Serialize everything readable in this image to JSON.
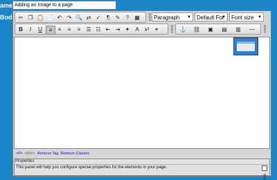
{
  "form": {
    "name_label": "ame",
    "body_label": "Body",
    "name_value": "Adding an Image to a page"
  },
  "toolbar": {
    "row1_buttons": [
      {
        "icon": "cut-icon",
        "glyph": "✂"
      },
      {
        "icon": "copy-icon",
        "glyph": "❐"
      },
      {
        "icon": "paste-icon",
        "glyph": "📋"
      },
      {
        "icon": "paste-text-icon",
        "glyph": "📄"
      },
      {
        "icon": "undo-icon",
        "glyph": "↶"
      },
      {
        "icon": "redo-icon",
        "glyph": "↷"
      },
      {
        "icon": "find-icon",
        "glyph": "🔍"
      },
      {
        "icon": "replace-icon",
        "glyph": "⇄"
      },
      {
        "icon": "spellcheck-icon",
        "glyph": "✓"
      },
      {
        "icon": "show-blocks-icon",
        "glyph": "¶"
      },
      {
        "icon": "cleanup-icon",
        "glyph": "✎"
      },
      {
        "icon": "help-icon",
        "glyph": "?"
      },
      {
        "icon": "source-icon",
        "glyph": "▦"
      }
    ],
    "paragraph_select": "Paragraph",
    "font_select": "Default For",
    "size_select": "Font size",
    "row2_buttons": [
      {
        "icon": "bold-icon",
        "glyph": "B"
      },
      {
        "icon": "italic-icon",
        "glyph": "I"
      },
      {
        "icon": "underline-icon",
        "glyph": "U"
      },
      {
        "icon": "align-left-icon",
        "glyph": "≡"
      },
      {
        "icon": "align-center-icon",
        "glyph": "≡"
      },
      {
        "icon": "align-right-icon",
        "glyph": "≡"
      },
      {
        "icon": "align-justify-icon",
        "glyph": "≡"
      },
      {
        "icon": "bullet-list-icon",
        "glyph": "☰"
      },
      {
        "icon": "numbered-list-icon",
        "glyph": "☷"
      },
      {
        "icon": "outdent-icon",
        "glyph": "⇤"
      },
      {
        "icon": "indent-icon",
        "glyph": "⇥"
      },
      {
        "icon": "highlight-color-icon",
        "glyph": "✦"
      },
      {
        "icon": "text-color-icon",
        "glyph": "A"
      },
      {
        "icon": "superscript-icon",
        "glyph": "x²"
      },
      {
        "icon": "link-icon",
        "glyph": "⚭"
      },
      {
        "icon": "anchor-icon",
        "glyph": "⚓"
      },
      {
        "icon": "unlink-icon",
        "glyph": "⛓"
      },
      {
        "icon": "image-icon",
        "glyph": "▣"
      },
      {
        "icon": "media-icon",
        "glyph": "▤"
      },
      {
        "icon": "table-icon",
        "glyph": "▥"
      },
      {
        "icon": "hr-icon",
        "glyph": "—"
      }
    ]
  },
  "statusbar": {
    "path_p": "<P>",
    "path_div": "<DIV>",
    "remove_tag": "Remove Tag",
    "remove_classes": "Remove Classes"
  },
  "properties": {
    "title": "Properties",
    "description": "This panel will help you configure special properties for the elements in your page.",
    "side_label": "Wiki"
  },
  "colors": {
    "background": "#1a85c8",
    "toolbar": "#d6d6d6",
    "link": "#1111cc"
  }
}
